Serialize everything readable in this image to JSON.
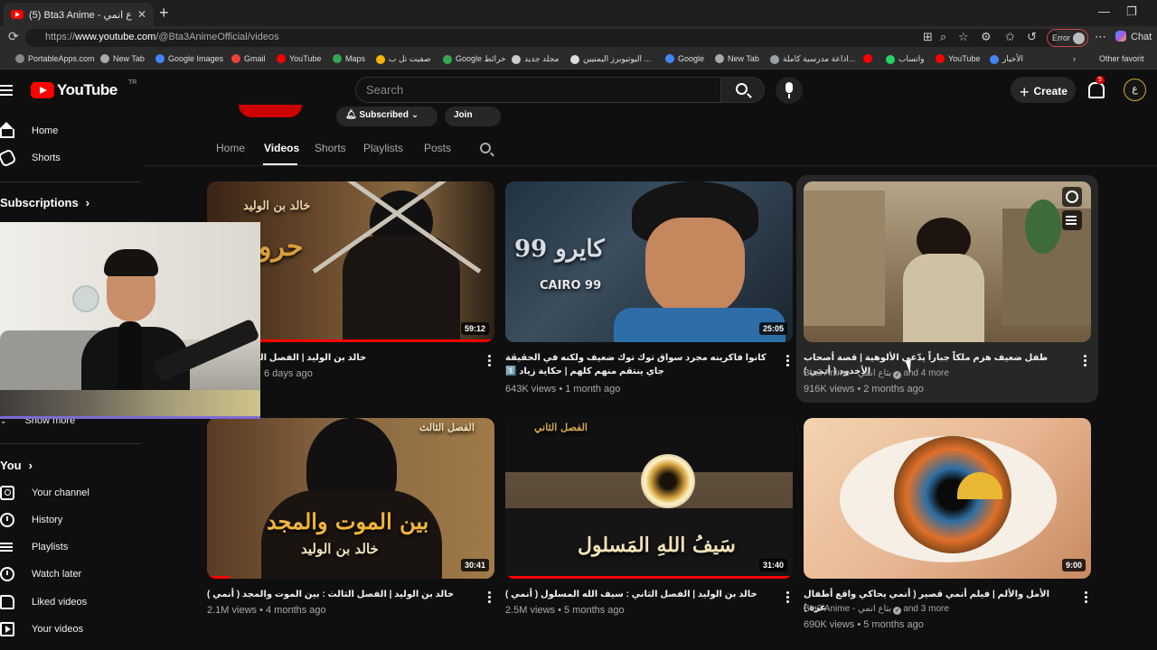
{
  "browser": {
    "tab_title": "(5) Bta3 Anime - بتاع انمي - YouTube",
    "url_prefix": "https://",
    "url_host": "www.youtube.com",
    "url_path": "/@Bta3AnimeOfficial/videos",
    "error_label": "Error",
    "chat_label": "Chat",
    "bookmarks": [
      {
        "label": "PortableApps.com",
        "color": "#888888"
      },
      {
        "label": "New Tab",
        "color": "#aaaaaa"
      },
      {
        "label": "Google Images",
        "color": "#4285f4"
      },
      {
        "label": "Gmail",
        "color": "#ea4335"
      },
      {
        "label": "YouTube",
        "color": "#ff0000"
      },
      {
        "label": "Maps",
        "color": "#34a853"
      },
      {
        "label": "صفيت تل ب",
        "color": "#f4b400"
      },
      {
        "label": "Google خرائط",
        "color": "#34a853"
      },
      {
        "label": "مجلد جديد",
        "color": "#cccccc"
      },
      {
        "label": "اليوتيوبرز اليمنيين ...",
        "color": "#dddddd"
      },
      {
        "label": "Google",
        "color": "#4285f4"
      },
      {
        "label": "New Tab",
        "color": "#aaaaaa"
      },
      {
        "label": "اذاعة مدرسية كاملة...",
        "color": "#9aa0a6"
      },
      {
        "label": "",
        "color": "#ff0000"
      },
      {
        "label": "واتساب",
        "color": "#25d366"
      },
      {
        "label": "YouTube",
        "color": "#ff0000"
      },
      {
        "label": "الأخبار",
        "color": "#4285f4"
      }
    ],
    "other_favorites": "Other favorit"
  },
  "youtube": {
    "logo_text": "YouTube",
    "country": "TR",
    "search_placeholder": "Search",
    "create_label": "Create",
    "notif_count": "5"
  },
  "sidebar": {
    "home": "Home",
    "shorts": "Shorts",
    "subscriptions": "Subscriptions",
    "show_more": "Show more",
    "you": "You",
    "items": [
      "Your channel",
      "History",
      "Playlists",
      "Watch later",
      "Liked videos",
      "Your videos"
    ]
  },
  "channel": {
    "subscribed": "Subscribed",
    "join": "Join",
    "tabs": [
      "Home",
      "Videos",
      "Shorts",
      "Playlists",
      "Posts"
    ],
    "active_tab": "Videos"
  },
  "videos": [
    {
      "title": "خالد بن الوليد | الفصل الرابع : حروب",
      "views": "",
      "age": "6 days ago",
      "duration": "59:12",
      "progress": 1.0,
      "thumb_text": "حروب ا",
      "thumb_sub": "خالد بن الوليد"
    },
    {
      "title": "كانوا فاكرينه مجرد سواق توك توك ضعيف ولكنه في الحقيقة جاي ينتقم منهم كلهم | حكاية زياد 1️⃣",
      "views": "643K views",
      "age": "1 month ago",
      "duration": "25:05",
      "progress": 0,
      "thumb_text": "كايرو 99",
      "thumb_sub": "CAIRO 99"
    },
    {
      "title": "طفل ضعيف هزم ملكاً جباراً يدّعي الألوهية | قصة أصحاب الأخدود ( أنمي )",
      "channel": "Bta3 Anime - بتاع انمي",
      "others": "and 4 more",
      "views": "916K views",
      "age": "2 months ago",
      "duration": "",
      "progress": 0
    },
    {
      "title": "خالد بن الوليد | الفصل الثالث : بين الموت والمجد ( أنمي )",
      "views": "2.1M views",
      "age": "4 months ago",
      "duration": "30:41",
      "progress": 0.08,
      "thumb_text": "بين الموت والمجد",
      "thumb_sub": "خالد بن الوليد",
      "corner": "الفصل الثالث"
    },
    {
      "title": "خالد بن الوليد | الفصل الثاني : سيف الله المسلول ( أنمي )",
      "views": "2.5M views",
      "age": "5 months ago",
      "duration": "31:40",
      "progress": 1.0,
      "thumb_text": "سَيفُ اللهِ المَسلول",
      "corner": "الفصل الثاني"
    },
    {
      "title": "الأمل والألم | فيلم أنمي قصير ( أنمي يحاكي واقع أطفال غزة )",
      "channel": "Bta3 Anime - بتاع انمي",
      "others": "and 3 more",
      "views": "690K views",
      "age": "5 months ago",
      "duration": "9:00",
      "progress": 0
    }
  ],
  "colors": {
    "accent_red": "#ff0000",
    "bg": "#0f0f0f"
  }
}
